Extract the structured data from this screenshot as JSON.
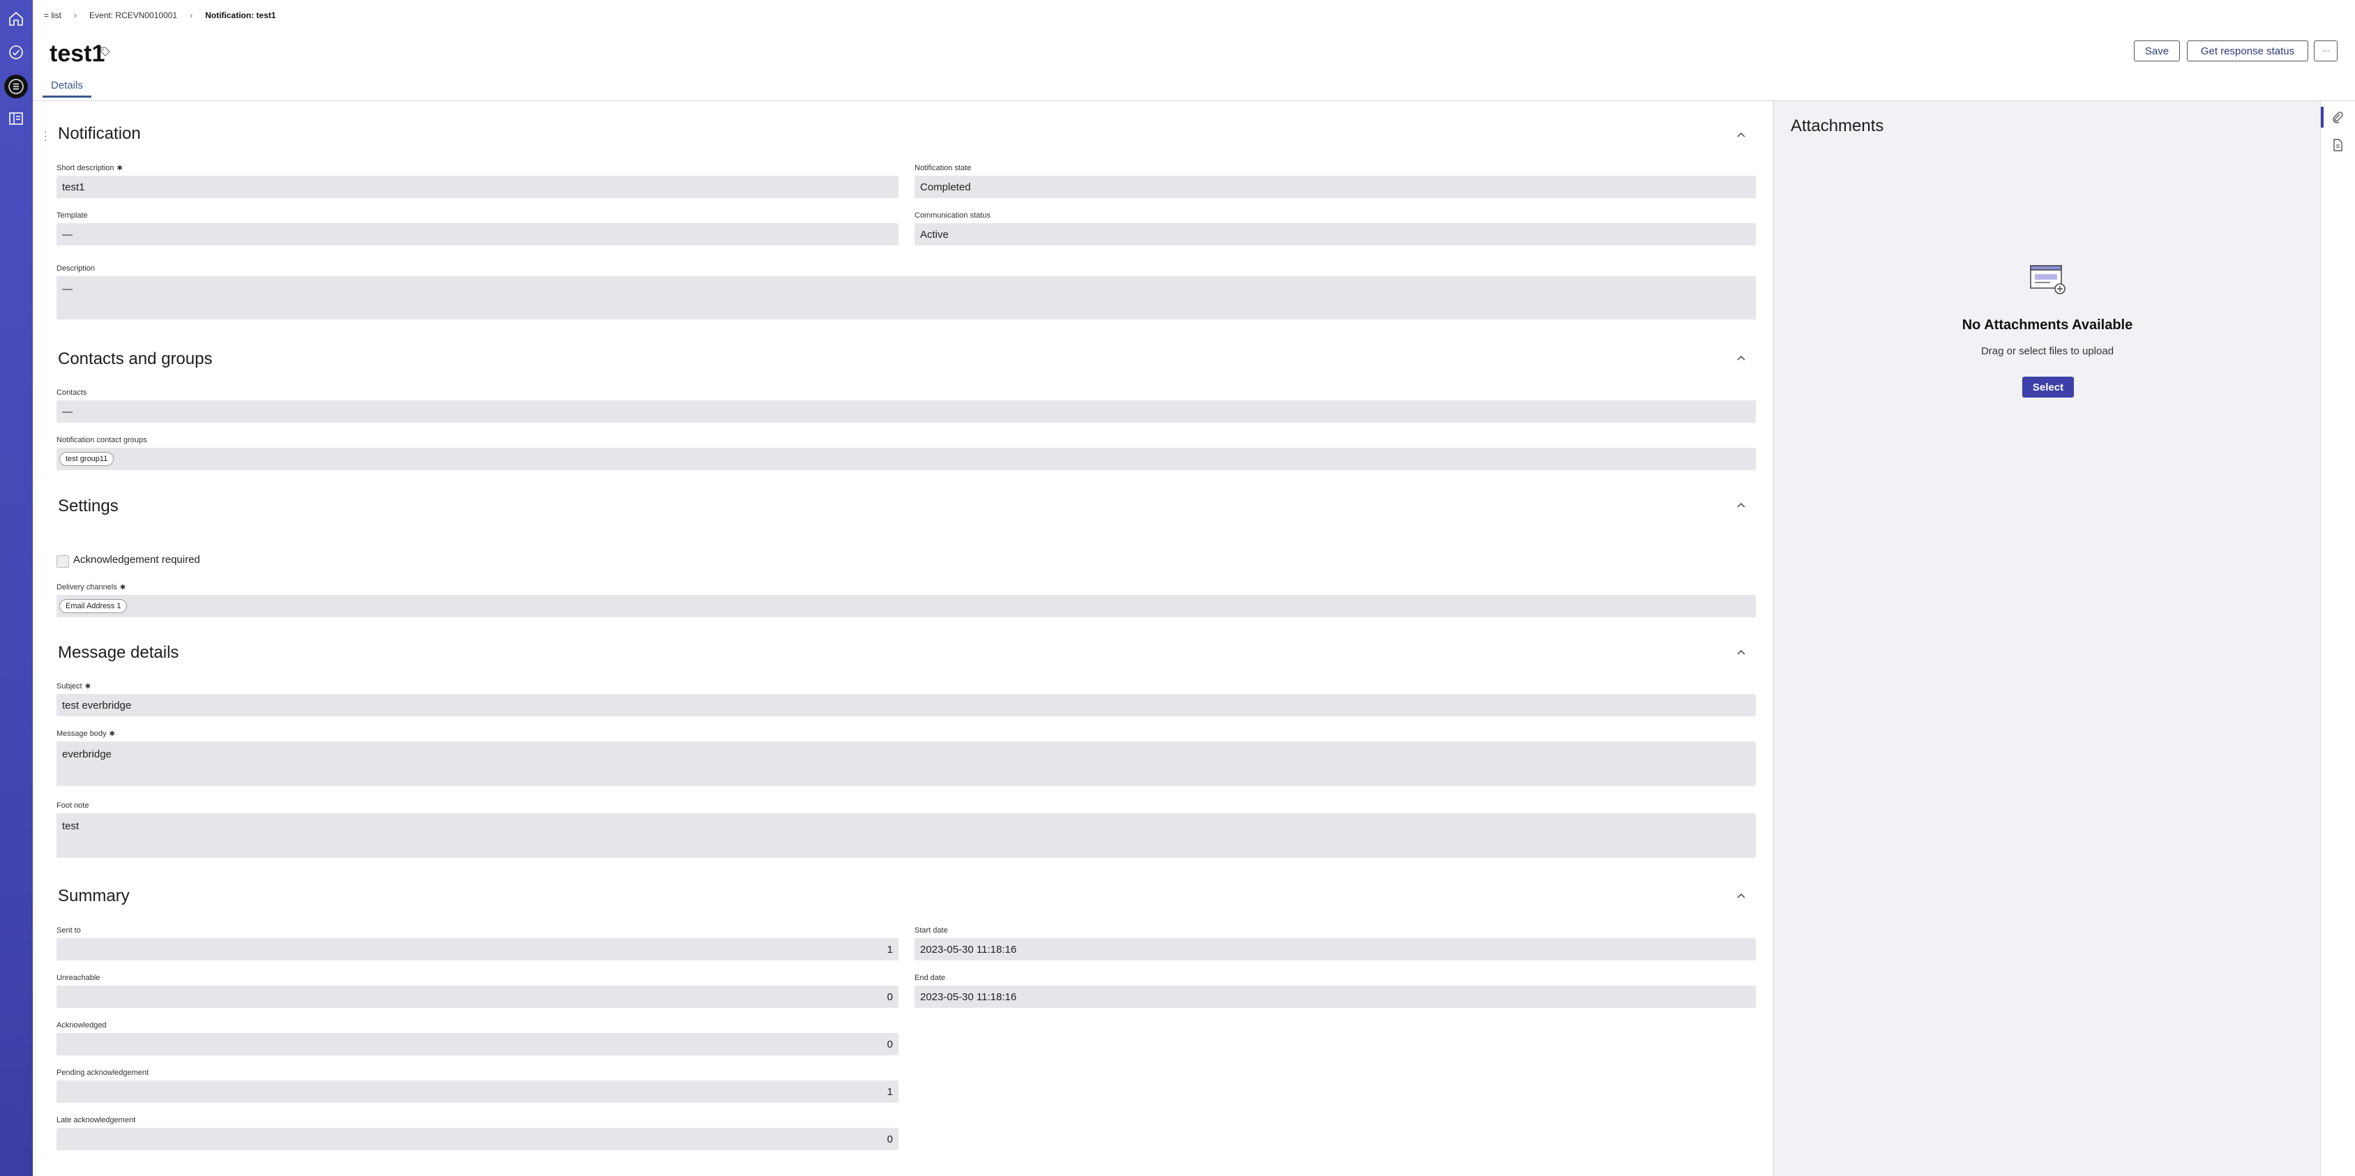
{
  "breadcrumb": {
    "items": [
      "= list",
      "Event: RCEVN0010001",
      "Notification: test1"
    ]
  },
  "header": {
    "title": "test1",
    "tabs": [
      "Details"
    ],
    "buttons": {
      "save": "Save",
      "response": "Get response status",
      "more": "···"
    }
  },
  "sections": {
    "notification": "Notification",
    "contacts": "Contacts and groups",
    "settings": "Settings",
    "message": "Message details",
    "summary": "Summary"
  },
  "notification": {
    "short_description": {
      "label": "Short description",
      "value": "test1"
    },
    "state": {
      "label": "Notification state",
      "value": "Completed"
    },
    "template": {
      "label": "Template",
      "value": "—"
    },
    "comm_status": {
      "label": "Communication status",
      "value": "Active"
    },
    "description": {
      "label": "Description",
      "value": "—"
    }
  },
  "contacts": {
    "contacts": {
      "label": "Contacts",
      "value": "—"
    },
    "groups": {
      "label": "Notification contact groups",
      "value": "test group11"
    }
  },
  "settings": {
    "ack": {
      "label": "Acknowledgement required",
      "checked": false
    },
    "delivery": {
      "label": "Delivery channels",
      "value": "Email Address 1"
    }
  },
  "message": {
    "subject": {
      "label": "Subject",
      "value": "test everbridge"
    },
    "body": {
      "label": "Message body",
      "value": "everbridge"
    },
    "foot": {
      "label": "Foot note",
      "value": "test"
    }
  },
  "summary": {
    "sent_to": {
      "label": "Sent to",
      "value": "1"
    },
    "start_date": {
      "label": "Start date",
      "value": "2023-05-30 11:18:16"
    },
    "unreachable": {
      "label": "Unreachable",
      "value": "0"
    },
    "end_date": {
      "label": "End date",
      "value": "2023-05-30 11:18:16"
    },
    "acknowledged": {
      "label": "Acknowledged",
      "value": "0"
    },
    "pending": {
      "label": "Pending acknowledgement",
      "value": "1"
    },
    "late": {
      "label": "Late acknowledgement",
      "value": "0"
    }
  },
  "required_mark": "✱",
  "attachments": {
    "title": "Attachments",
    "empty_title": "No Attachments Available",
    "empty_hint": "Drag or select files to upload",
    "select_label": "Select"
  },
  "colors": {
    "nav": "#4a4fbf",
    "accent": "#3d3fa8",
    "field": "#e6e6ea"
  }
}
